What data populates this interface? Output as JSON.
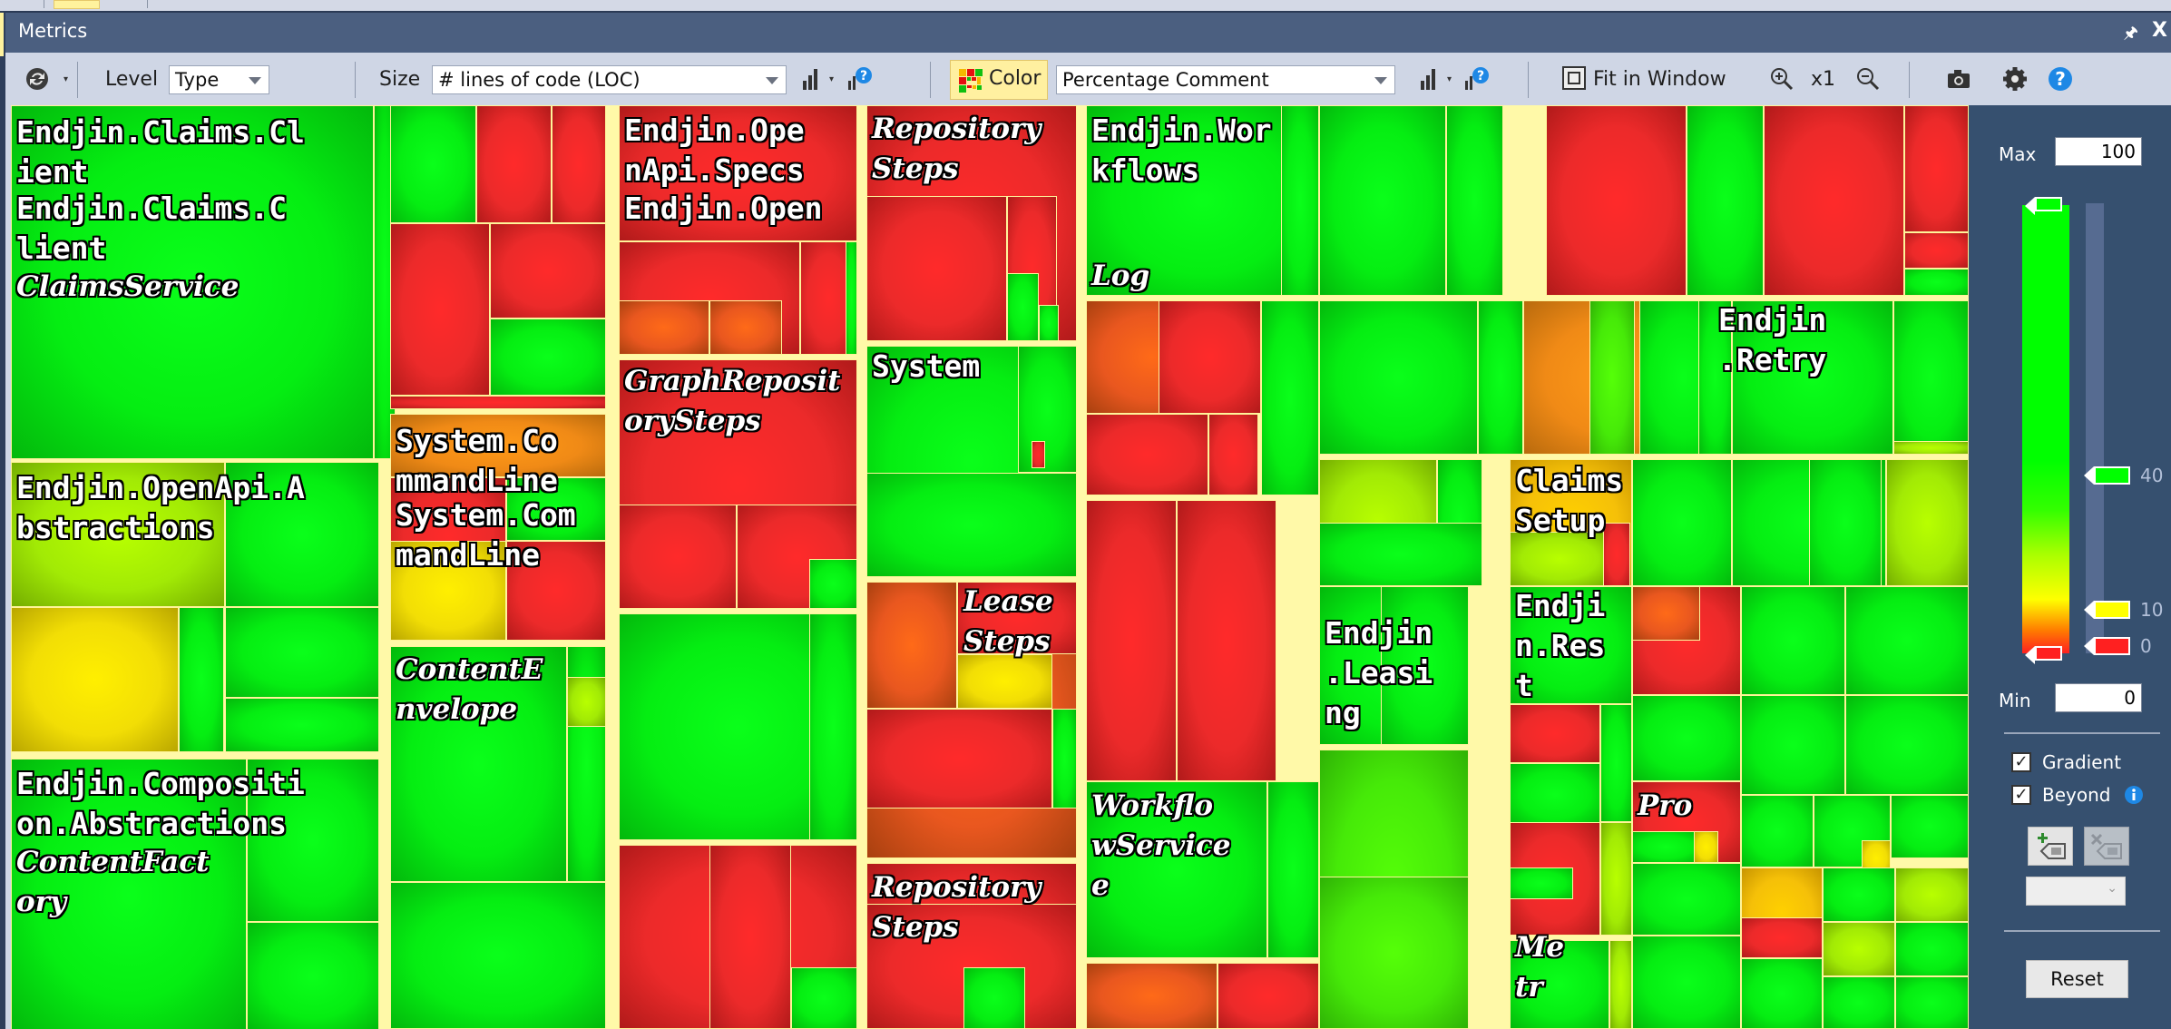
{
  "window": {
    "title": "Metrics",
    "pin_icon": "pin-icon",
    "close_label": "X"
  },
  "toolbar": {
    "refresh_icon": "refresh-icon",
    "level_label": "Level",
    "level_value": "Type",
    "size_label": "Size",
    "size_value": "# lines of code (LOC)",
    "color_label": "Color",
    "color_value": "Percentage Comment",
    "fit_label": "Fit in Window",
    "zoom_level": "x1",
    "icons": [
      "bar-chart-icon",
      "metric-help-icon",
      "color-grid-icon",
      "fit-window-icon",
      "zoom-in-icon",
      "zoom-out-icon",
      "camera-icon",
      "gear-icon",
      "help-icon"
    ]
  },
  "treemap": {
    "labels": {
      "claims_client_ns": "Endjin.Claims.Cl\nient",
      "claims_client_asm": "Endjin.Claims.C\nlient",
      "claims_service": "ClaimsService",
      "openapi_specs": "Endjin.Ope\nnApi.Specs",
      "endjin_open": "Endjin.Open",
      "repository_steps_1": "Repository\nSteps",
      "workflows": "Endjin.Wor\nkflows",
      "log": "Log",
      "graph_repo_steps": "GraphReposit\norySteps",
      "system": "System",
      "retry": "Endjin\n.Retry",
      "openapi_abstractions": "Endjin.OpenApi.A\nbstractions",
      "commandline_1": "System.Co\nmmandLine",
      "commandline_2": "System.Com\nmandLine",
      "claims_setup": "Claims\nSetup",
      "lease_steps": "Lease\nSteps",
      "leasing": "Endjin\n.Leasi\nng",
      "rest": "Endji\nn.Res\nt",
      "workflow_service": "Workflo\nwService\ne",
      "composition_abstractions": "Endjin.Compositi\non.Abstractions",
      "content_factory": "ContentFact\nory",
      "content_envelope": "ContentE\nnvelope",
      "repository_steps_2": "Repository\nSteps",
      "pro": "Pro",
      "metr": "Me\ntr"
    }
  },
  "legend": {
    "max_label": "Max",
    "max_value": "100",
    "min_label": "Min",
    "min_value": "0",
    "thresholds": [
      {
        "value": "40",
        "color": "#00ff00"
      },
      {
        "value": "10",
        "color": "#ffff00"
      },
      {
        "value": "0",
        "color": "#ff2020"
      }
    ],
    "top_color": "#00ff00",
    "bottom_color": "#ff2020",
    "gradient_label": "Gradient",
    "gradient_checked": true,
    "beyond_label": "Beyond",
    "beyond_checked": true,
    "reset_label": "Reset"
  }
}
